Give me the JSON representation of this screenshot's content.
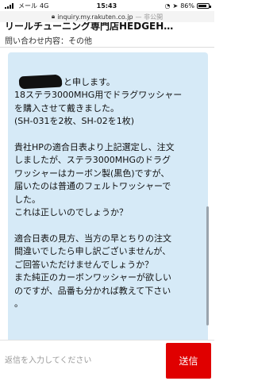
{
  "status_bar": {
    "carrier": "メール",
    "network": "4G",
    "time": "15:43",
    "battery": "86%",
    "battery_level": 0.86
  },
  "url_bar": {
    "domain": "inquiry.my.rakuten.co.jp",
    "visibility": "— 非公開",
    "lock_icon": "lock-icon"
  },
  "header": {
    "shop_title": "リールチューニング専門店HEDGEH…",
    "subject": "問い合わせ内容：その他"
  },
  "message": {
    "lines": [
      "と申します。",
      "18ステラ3000MHG用でドラグワッシャー",
      "を購入させて戴きました。",
      "(SH-031を2枚、SH-02を1枚)",
      "",
      "貴社HPの適合日表より上記選定し、注文",
      "しましたが、ステラ3000MHGのドラグ",
      "ワッシャーはカーボン製(黒色)ですが、",
      "届いたのは普通のフェルトワッシャーで",
      "した。",
      "これは正しいのでしょうか？",
      "",
      "適合日表の見方、当方の早とちりの注文",
      "間違いでしたら申し訳ございませんが、",
      "ご回答いただけませんでしょうか？",
      "また純正のカーボンワッシャーが欲しい",
      "のですが、品番も分かれば教えて下さい",
      "。"
    ]
  },
  "composer": {
    "placeholder": "返信を入力してください",
    "send_label": "送信"
  }
}
